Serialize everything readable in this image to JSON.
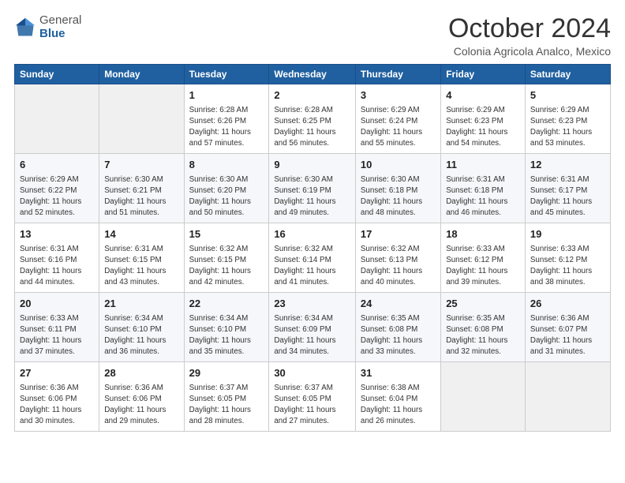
{
  "logo": {
    "general": "General",
    "blue": "Blue"
  },
  "header": {
    "month": "October 2024",
    "location": "Colonia Agricola Analco, Mexico"
  },
  "weekdays": [
    "Sunday",
    "Monday",
    "Tuesday",
    "Wednesday",
    "Thursday",
    "Friday",
    "Saturday"
  ],
  "weeks": [
    [
      {
        "day": "",
        "info": ""
      },
      {
        "day": "",
        "info": ""
      },
      {
        "day": "1",
        "info": "Sunrise: 6:28 AM\nSunset: 6:26 PM\nDaylight: 11 hours and 57 minutes."
      },
      {
        "day": "2",
        "info": "Sunrise: 6:28 AM\nSunset: 6:25 PM\nDaylight: 11 hours and 56 minutes."
      },
      {
        "day": "3",
        "info": "Sunrise: 6:29 AM\nSunset: 6:24 PM\nDaylight: 11 hours and 55 minutes."
      },
      {
        "day": "4",
        "info": "Sunrise: 6:29 AM\nSunset: 6:23 PM\nDaylight: 11 hours and 54 minutes."
      },
      {
        "day": "5",
        "info": "Sunrise: 6:29 AM\nSunset: 6:23 PM\nDaylight: 11 hours and 53 minutes."
      }
    ],
    [
      {
        "day": "6",
        "info": "Sunrise: 6:29 AM\nSunset: 6:22 PM\nDaylight: 11 hours and 52 minutes."
      },
      {
        "day": "7",
        "info": "Sunrise: 6:30 AM\nSunset: 6:21 PM\nDaylight: 11 hours and 51 minutes."
      },
      {
        "day": "8",
        "info": "Sunrise: 6:30 AM\nSunset: 6:20 PM\nDaylight: 11 hours and 50 minutes."
      },
      {
        "day": "9",
        "info": "Sunrise: 6:30 AM\nSunset: 6:19 PM\nDaylight: 11 hours and 49 minutes."
      },
      {
        "day": "10",
        "info": "Sunrise: 6:30 AM\nSunset: 6:18 PM\nDaylight: 11 hours and 48 minutes."
      },
      {
        "day": "11",
        "info": "Sunrise: 6:31 AM\nSunset: 6:18 PM\nDaylight: 11 hours and 46 minutes."
      },
      {
        "day": "12",
        "info": "Sunrise: 6:31 AM\nSunset: 6:17 PM\nDaylight: 11 hours and 45 minutes."
      }
    ],
    [
      {
        "day": "13",
        "info": "Sunrise: 6:31 AM\nSunset: 6:16 PM\nDaylight: 11 hours and 44 minutes."
      },
      {
        "day": "14",
        "info": "Sunrise: 6:31 AM\nSunset: 6:15 PM\nDaylight: 11 hours and 43 minutes."
      },
      {
        "day": "15",
        "info": "Sunrise: 6:32 AM\nSunset: 6:15 PM\nDaylight: 11 hours and 42 minutes."
      },
      {
        "day": "16",
        "info": "Sunrise: 6:32 AM\nSunset: 6:14 PM\nDaylight: 11 hours and 41 minutes."
      },
      {
        "day": "17",
        "info": "Sunrise: 6:32 AM\nSunset: 6:13 PM\nDaylight: 11 hours and 40 minutes."
      },
      {
        "day": "18",
        "info": "Sunrise: 6:33 AM\nSunset: 6:12 PM\nDaylight: 11 hours and 39 minutes."
      },
      {
        "day": "19",
        "info": "Sunrise: 6:33 AM\nSunset: 6:12 PM\nDaylight: 11 hours and 38 minutes."
      }
    ],
    [
      {
        "day": "20",
        "info": "Sunrise: 6:33 AM\nSunset: 6:11 PM\nDaylight: 11 hours and 37 minutes."
      },
      {
        "day": "21",
        "info": "Sunrise: 6:34 AM\nSunset: 6:10 PM\nDaylight: 11 hours and 36 minutes."
      },
      {
        "day": "22",
        "info": "Sunrise: 6:34 AM\nSunset: 6:10 PM\nDaylight: 11 hours and 35 minutes."
      },
      {
        "day": "23",
        "info": "Sunrise: 6:34 AM\nSunset: 6:09 PM\nDaylight: 11 hours and 34 minutes."
      },
      {
        "day": "24",
        "info": "Sunrise: 6:35 AM\nSunset: 6:08 PM\nDaylight: 11 hours and 33 minutes."
      },
      {
        "day": "25",
        "info": "Sunrise: 6:35 AM\nSunset: 6:08 PM\nDaylight: 11 hours and 32 minutes."
      },
      {
        "day": "26",
        "info": "Sunrise: 6:36 AM\nSunset: 6:07 PM\nDaylight: 11 hours and 31 minutes."
      }
    ],
    [
      {
        "day": "27",
        "info": "Sunrise: 6:36 AM\nSunset: 6:06 PM\nDaylight: 11 hours and 30 minutes."
      },
      {
        "day": "28",
        "info": "Sunrise: 6:36 AM\nSunset: 6:06 PM\nDaylight: 11 hours and 29 minutes."
      },
      {
        "day": "29",
        "info": "Sunrise: 6:37 AM\nSunset: 6:05 PM\nDaylight: 11 hours and 28 minutes."
      },
      {
        "day": "30",
        "info": "Sunrise: 6:37 AM\nSunset: 6:05 PM\nDaylight: 11 hours and 27 minutes."
      },
      {
        "day": "31",
        "info": "Sunrise: 6:38 AM\nSunset: 6:04 PM\nDaylight: 11 hours and 26 minutes."
      },
      {
        "day": "",
        "info": ""
      },
      {
        "day": "",
        "info": ""
      }
    ]
  ]
}
